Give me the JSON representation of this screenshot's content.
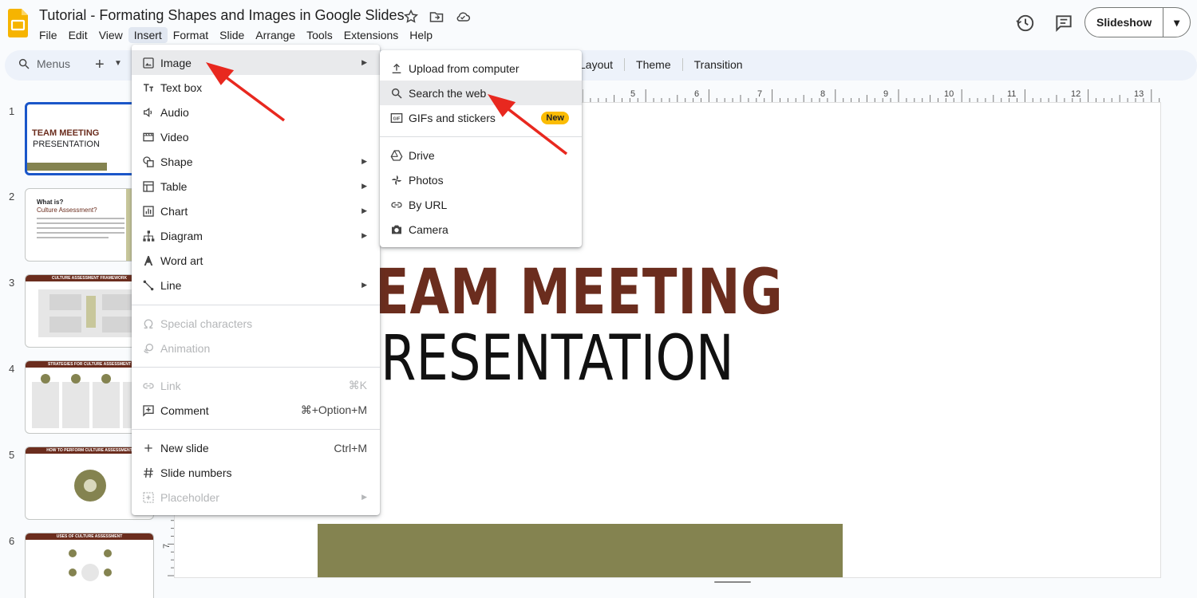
{
  "doc": {
    "title": "Tutorial - Formating Shapes and Images in Google Slides"
  },
  "menubar": [
    "File",
    "Edit",
    "View",
    "Insert",
    "Format",
    "Slide",
    "Arrange",
    "Tools",
    "Extensions",
    "Help"
  ],
  "header": {
    "slideshow_label": "Slideshow"
  },
  "toolbar": {
    "search_placeholder": "Menus",
    "items": [
      "Layout",
      "Theme",
      "Transition"
    ]
  },
  "ruler": {
    "top_ticks": [
      "5",
      "6",
      "7",
      "8",
      "9",
      "10",
      "11",
      "12",
      "13"
    ],
    "left_tick": "7"
  },
  "insert_menu": {
    "items": [
      {
        "label": "Image",
        "submenu": true,
        "icon": "image-icon"
      },
      {
        "label": "Text box",
        "icon": "text-box-icon"
      },
      {
        "label": "Audio",
        "icon": "audio-icon"
      },
      {
        "label": "Video",
        "icon": "video-icon"
      },
      {
        "label": "Shape",
        "submenu": true,
        "icon": "shape-icon"
      },
      {
        "label": "Table",
        "submenu": true,
        "icon": "table-icon"
      },
      {
        "label": "Chart",
        "submenu": true,
        "icon": "chart-icon"
      },
      {
        "label": "Diagram",
        "submenu": true,
        "icon": "diagram-icon"
      },
      {
        "label": "Word art",
        "icon": "word-art-icon"
      },
      {
        "label": "Line",
        "submenu": true,
        "icon": "line-icon"
      },
      {
        "label": "Special characters",
        "disabled": true,
        "icon": "omega-icon"
      },
      {
        "label": "Animation",
        "disabled": true,
        "icon": "animation-icon"
      },
      {
        "label": "Link",
        "shortcut": "⌘K",
        "disabled": true,
        "icon": "link-icon"
      },
      {
        "label": "Comment",
        "shortcut": "⌘+Option+M",
        "icon": "comment-icon"
      },
      {
        "label": "New slide",
        "shortcut": "Ctrl+M",
        "icon": "plus-icon"
      },
      {
        "label": "Slide numbers",
        "icon": "hash-icon"
      },
      {
        "label": "Placeholder",
        "submenu": true,
        "disabled": true,
        "icon": "placeholder-icon"
      }
    ]
  },
  "image_submenu": {
    "items": [
      {
        "label": "Upload from computer",
        "icon": "upload-icon"
      },
      {
        "label": "Search the web",
        "icon": "search-icon"
      },
      {
        "label": "GIFs and stickers",
        "icon": "gif-icon",
        "badge": "New"
      },
      {
        "label": "Drive",
        "icon": "drive-icon"
      },
      {
        "label": "Photos",
        "icon": "photos-icon"
      },
      {
        "label": "By URL",
        "icon": "url-link-icon"
      },
      {
        "label": "Camera",
        "icon": "camera-icon"
      }
    ]
  },
  "slide": {
    "title_line1": "EAM MEETING",
    "title_line2": "RESENTATION"
  },
  "filmstrip": {
    "numbers": [
      "1",
      "2",
      "3",
      "4",
      "5",
      "6"
    ],
    "thumb1": {
      "title": "TEAM MEETING",
      "subtitle": "PRESENTATION"
    },
    "thumb2": {
      "title": "What is?",
      "subtitle": "Culture Assessment?"
    },
    "thumb3": {
      "title": "CULTURE ASSESSMENT FRAMEWORK"
    },
    "thumb4": {
      "title": "STRATEGIES FOR CULTURE ASSESSMENT"
    },
    "thumb5": {
      "title": "HOW TO PERFORM CULTURE ASSESSMENT"
    },
    "thumb6": {
      "title": "USES OF CULTURE ASSESSMENT"
    }
  },
  "colors": {
    "accent": "#1a56c9",
    "brand_brown": "#6b2d1e",
    "olive": "#848350",
    "arrow": "#e8281f",
    "badge": "#fbbc04"
  }
}
